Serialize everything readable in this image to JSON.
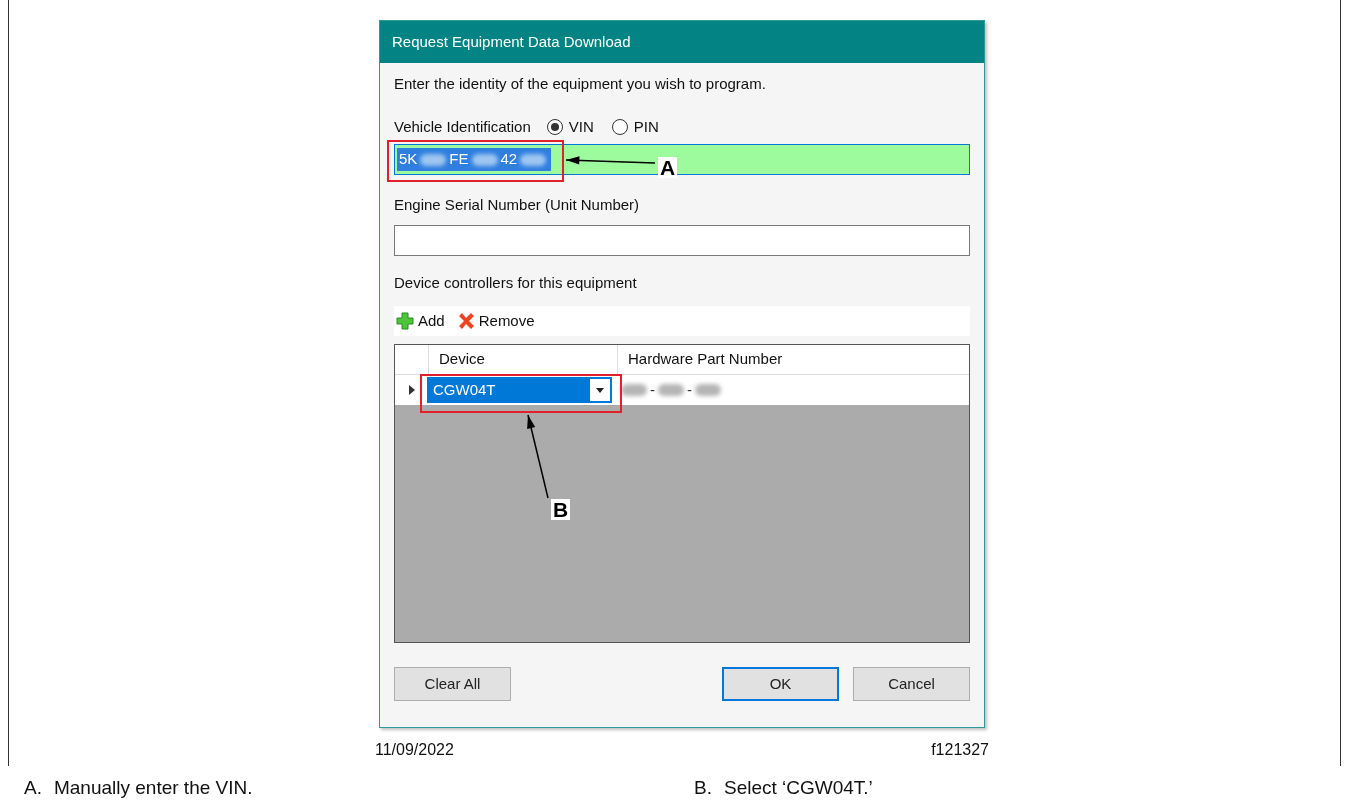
{
  "dialog": {
    "title": "Request Equipment Data Download",
    "intro": "Enter the identity of the equipment you wish to program.",
    "vehicle_id": {
      "label": "Vehicle Identification",
      "options": [
        {
          "label": "VIN",
          "selected": true
        },
        {
          "label": "PIN",
          "selected": false
        }
      ],
      "value_parts": [
        "5K",
        "FE",
        "42"
      ],
      "text_selected": true
    },
    "engine_serial": {
      "label": "Engine Serial Number (Unit Number)"
    },
    "devices": {
      "label": "Device controllers for this equipment",
      "toolbar": [
        {
          "kind": "add",
          "label": "Add"
        },
        {
          "kind": "remove",
          "label": "Remove"
        }
      ],
      "columns": [
        "Device",
        "Hardware Part Number"
      ],
      "rows": [
        {
          "current": true,
          "device": "CGW04T",
          "part_number_parts": [
            "-",
            "-"
          ]
        }
      ]
    },
    "buttons": [
      {
        "label": "Clear All",
        "default": false
      },
      {
        "label": "OK",
        "default": true
      },
      {
        "label": "Cancel",
        "default": false
      }
    ]
  },
  "callouts": [
    {
      "letter": "A"
    },
    {
      "letter": "B"
    }
  ],
  "figure": {
    "date": "11/09/2022",
    "figure_id": "f121327"
  },
  "captions": [
    {
      "letter": "A.",
      "text": "Manually enter the VIN."
    },
    {
      "letter": "B.",
      "text": "Select ‘CGW04T.’"
    }
  ]
}
